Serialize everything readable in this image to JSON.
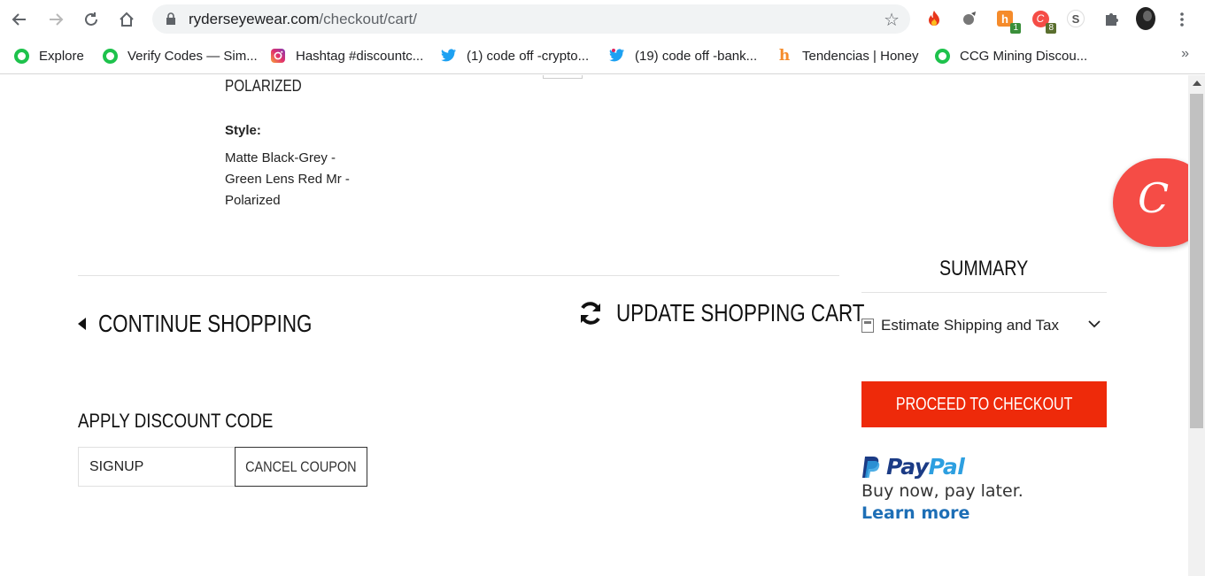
{
  "browser": {
    "url_domain": "ryderseyewear.com",
    "url_path": "/checkout/cart/",
    "extensions": [
      {
        "name": "fire-extension-icon"
      },
      {
        "name": "chart-extension-icon"
      },
      {
        "name": "honey-extension-icon",
        "badge": "1",
        "badge_color": "#3a8f3a"
      },
      {
        "name": "coupon-extension-icon",
        "badge": "8",
        "badge_color": "#5a6f2e"
      },
      {
        "name": "s-extension-icon",
        "label": "S"
      },
      {
        "name": "puzzle-extension-icon"
      },
      {
        "name": "profile-avatar"
      }
    ]
  },
  "bookmarks": [
    {
      "label": "Explore",
      "icon": "green-ring-icon"
    },
    {
      "label": "Verify Codes — Sim...",
      "icon": "green-ring-icon"
    },
    {
      "label": "Hashtag #discountc...",
      "icon": "instagram-icon"
    },
    {
      "label": "(1) code off -crypto...",
      "icon": "twitter-icon"
    },
    {
      "label": "(19) code off -bank...",
      "icon": "twitter-icon"
    },
    {
      "label": "Tendencias | Honey",
      "icon": "honey-icon"
    },
    {
      "label": "CCG Mining Discou...",
      "icon": "green-ring-icon"
    }
  ],
  "bookmarks_more": "»",
  "product": {
    "name_tail": "POLARIZED",
    "style_label": "Style:",
    "style_value": "Matte Black-Grey - Green Lens Red Mr - Polarized"
  },
  "cart_actions": {
    "continue_label": "CONTINUE SHOPPING",
    "update_label": "UPDATE SHOPPING CART"
  },
  "discount": {
    "title": "APPLY DISCOUNT CODE",
    "code_value": "SIGNUP",
    "cancel_label": "CANCEL COUPON"
  },
  "summary": {
    "title": "SUMMARY",
    "estimate_label": "Estimate Shipping and Tax",
    "checkout_label": "PROCEED TO CHECKOUT"
  },
  "paypal": {
    "brand_1": "Pay",
    "brand_2": "Pal",
    "tagline": "Buy now, pay later.",
    "learn_more": "Learn more"
  },
  "colors": {
    "checkout": "#ee2a0a",
    "float_button": "#f54c46",
    "paypal_dark": "#1b3b85",
    "paypal_light": "#2d9fe0",
    "link": "#1e6fb6"
  }
}
